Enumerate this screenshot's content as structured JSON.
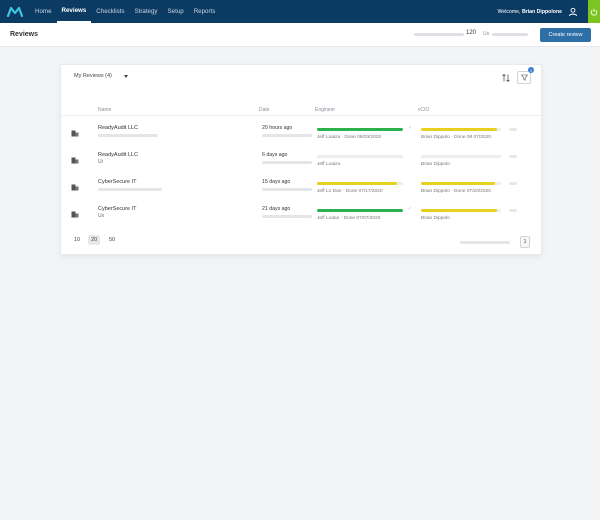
{
  "nav": {
    "items": [
      {
        "label": "Home",
        "active": false
      },
      {
        "label": "Reviews",
        "active": true
      },
      {
        "label": "Checklists",
        "active": false
      },
      {
        "label": "Strategy",
        "active": false
      },
      {
        "label": "Setup",
        "active": false
      },
      {
        "label": "Reports",
        "active": false
      }
    ],
    "welcome_prefix": "Welcome, ",
    "user_name": "Brian Dippolone",
    "accent_color": "#7bc421"
  },
  "header": {
    "title": "Reviews",
    "stat_value": "120",
    "stat_unit": "Us",
    "create_label": "Create review"
  },
  "toolbar": {
    "filter_label": "My Reviews (4)",
    "filter_badge": "1"
  },
  "table": {
    "columns": [
      "Name",
      "Date",
      "Engineer",
      "vCIO"
    ],
    "rows": [
      {
        "name": "ReadyAudit LLC",
        "sub": "",
        "date": "20 hours ago",
        "engineer": {
          "progress": 1.0,
          "color": "#2bb24c",
          "text": "Jeff Loaiza · Done 08/03/2020",
          "check": true
        },
        "vcio": {
          "progress": 0.93,
          "color": "#e5d21f",
          "text": "Brian Dippolo · Done 08 07/2020",
          "check": false
        }
      },
      {
        "name": "ReadyAudit LLC",
        "sub": "Ui",
        "date": "6 days ago",
        "engineer": {
          "progress": 0.0,
          "color": "#2bb24c",
          "text": "Jeff Loaiza",
          "check": false
        },
        "vcio": {
          "progress": 0.0,
          "color": "#e5d21f",
          "text": "Brian Dippolo",
          "check": false
        }
      },
      {
        "name": "CyberSecure IT",
        "sub": "",
        "date": "15 days ago",
        "engineer": {
          "progress": 0.88,
          "color": "#e5d21f",
          "text": "Jeff Lo Dan · Done 07/17/2020",
          "check": false
        },
        "vcio": {
          "progress": 0.86,
          "color": "#e5d21f",
          "text": "Brian Dippolo · Done 07/20/2020",
          "check": false
        }
      },
      {
        "name": "CyberSecure IT",
        "sub": "Ux",
        "date": "21 days ago",
        "engineer": {
          "progress": 1.0,
          "color": "#2bb24c",
          "text": "Jeff Lodan · Done 07/07/2020",
          "check": true
        },
        "vcio": {
          "progress": 0.93,
          "color": "#e5d21f",
          "text": "Brian Dippolo",
          "check": false
        }
      }
    ]
  },
  "pagination": {
    "sizes": [
      "10",
      "20",
      "50"
    ],
    "selected": "20",
    "current_page": "1"
  }
}
